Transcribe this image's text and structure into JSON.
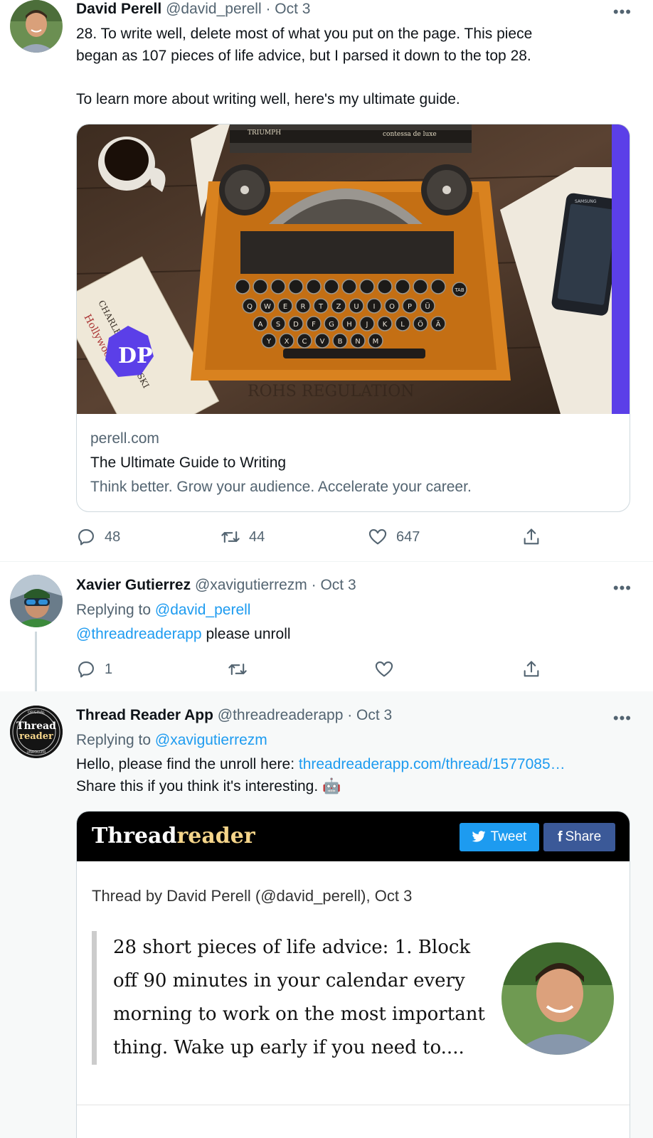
{
  "tweet1": {
    "name": "David Perell",
    "handle_date": "@david_perell · Oct 3",
    "more": "•••",
    "line1": "28. To write well, delete most of what you put on the page. This piece",
    "line2": "began as 107 pieces of life advice, but I parsed it down to the top 28.",
    "line3": "To learn more about writing well, here's my ultimate guide.",
    "card": {
      "domain": "perell.com",
      "title": "The Ultimate Guide to Writing",
      "description": "Think better. Grow your audience. Accelerate your career.",
      "image": {
        "brand_top": "TRIUMPH",
        "brand_right": "contessa de luxe",
        "book_author": "CHARLES BUKOWSKI",
        "book_title": "Hollywood",
        "logo": "DP",
        "desk_text": "ROHS REGULATION",
        "phone_brand": "SAMSUNG",
        "keys_row1": [
          "Q",
          "W",
          "E",
          "R",
          "T",
          "Z",
          "U",
          "I",
          "O",
          "P",
          "Ü"
        ],
        "keys_row2": [
          "A",
          "S",
          "D",
          "F",
          "G",
          "H",
          "J",
          "K",
          "L",
          "Ö",
          "Ä"
        ],
        "keys_row3": [
          "Y",
          "X",
          "C",
          "V",
          "B",
          "N",
          "M"
        ],
        "tab_key": "TAB"
      }
    },
    "replies": "48",
    "retweets": "44",
    "likes": "647"
  },
  "tweet2": {
    "name": "Xavier Gutierrez",
    "handle_date": "@xavigutierrezm · Oct 3",
    "more": "•••",
    "replying_label": "Replying to",
    "replying_handle": "@david_perell",
    "mention": "@threadreaderapp",
    "body": "please unroll",
    "replies": "1"
  },
  "tweet3": {
    "name": "Thread Reader App",
    "handle_date": "@threadreaderapp · Oct 3",
    "more": "•••",
    "avatar_line1": "Thread",
    "avatar_line2": "reader",
    "avatar_ring_top": "ORIGINAL",
    "avatar_ring_bottom": "UNROLLER",
    "replying_label": "Replying to",
    "replying_handle": "@xavigutierrezm",
    "body1": "Hello, please find the unroll here:",
    "link": "threadreaderapp.com/thread/1577085…",
    "body2": "Share this if you think it's interesting.",
    "emoji": "🤖",
    "card": {
      "brand_bold": "Thread",
      "brand_light": "reader",
      "tweet_btn": "Tweet",
      "share_btn": "Share",
      "byline": "Thread by David Perell (@david_perell), Oct 3",
      "quote1": "28 short pieces of life advice: 1. Block",
      "quote2": "off 90 minutes in your calendar every",
      "quote3": "morning to work on the most important",
      "quote4": "thing. Wake up early if you need to...."
    }
  },
  "colors": {
    "accent": "#1d9bf0",
    "secondary_text": "#536471",
    "border": "#cfd9de",
    "twitter_btn": "#1d9bf0",
    "facebook_btn": "#3b5998",
    "typewriter_orange": "#d9821f",
    "dp_purple": "#5b3fe8"
  }
}
